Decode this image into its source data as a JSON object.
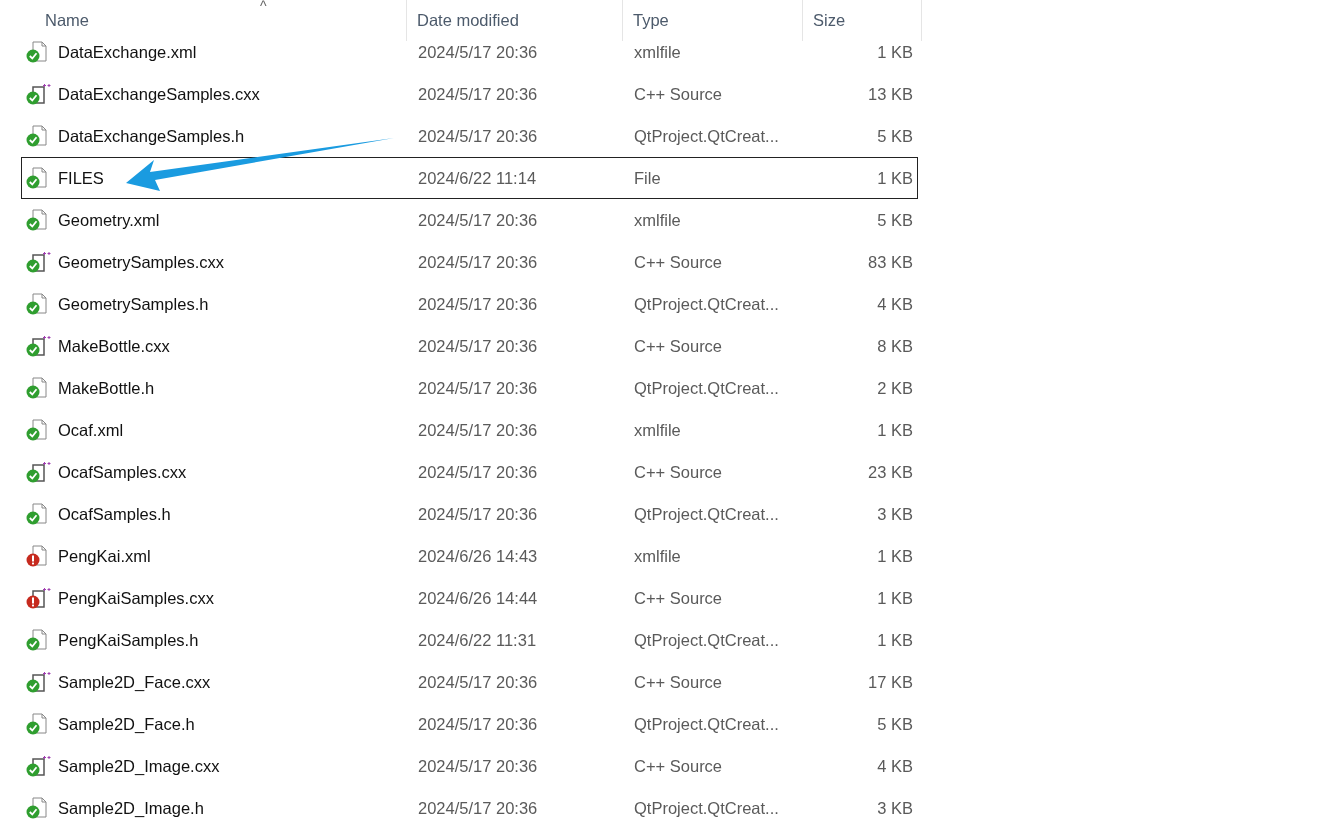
{
  "columns": [
    {
      "label": "Name",
      "sorted": true
    },
    {
      "label": "Date modified",
      "sorted": false
    },
    {
      "label": "Type",
      "sorted": false
    },
    {
      "label": "Size",
      "sorted": false
    }
  ],
  "sort_indicator": "^",
  "rows": [
    {
      "name": "DataExchange.xml",
      "date": "2024/5/17 20:36",
      "type": "xmlfile",
      "size": "1 KB",
      "kind": "document",
      "error": false,
      "focused": false
    },
    {
      "name": "DataExchangeSamples.cxx",
      "date": "2024/5/17 20:36",
      "type": "C++ Source",
      "size": "13 KB",
      "kind": "cpp",
      "error": false,
      "focused": false
    },
    {
      "name": "DataExchangeSamples.h",
      "date": "2024/5/17 20:36",
      "type": "QtProject.QtCreat...",
      "size": "5 KB",
      "kind": "document",
      "error": false,
      "focused": false
    },
    {
      "name": "FILES",
      "date": "2024/6/22 11:14",
      "type": "File",
      "size": "1 KB",
      "kind": "document",
      "error": false,
      "focused": true
    },
    {
      "name": "Geometry.xml",
      "date": "2024/5/17 20:36",
      "type": "xmlfile",
      "size": "5 KB",
      "kind": "document",
      "error": false,
      "focused": false
    },
    {
      "name": "GeometrySamples.cxx",
      "date": "2024/5/17 20:36",
      "type": "C++ Source",
      "size": "83 KB",
      "kind": "cpp",
      "error": false,
      "focused": false
    },
    {
      "name": "GeometrySamples.h",
      "date": "2024/5/17 20:36",
      "type": "QtProject.QtCreat...",
      "size": "4 KB",
      "kind": "document",
      "error": false,
      "focused": false
    },
    {
      "name": "MakeBottle.cxx",
      "date": "2024/5/17 20:36",
      "type": "C++ Source",
      "size": "8 KB",
      "kind": "cpp",
      "error": false,
      "focused": false
    },
    {
      "name": "MakeBottle.h",
      "date": "2024/5/17 20:36",
      "type": "QtProject.QtCreat...",
      "size": "2 KB",
      "kind": "document",
      "error": false,
      "focused": false
    },
    {
      "name": "Ocaf.xml",
      "date": "2024/5/17 20:36",
      "type": "xmlfile",
      "size": "1 KB",
      "kind": "document",
      "error": false,
      "focused": false
    },
    {
      "name": "OcafSamples.cxx",
      "date": "2024/5/17 20:36",
      "type": "C++ Source",
      "size": "23 KB",
      "kind": "cpp",
      "error": false,
      "focused": false
    },
    {
      "name": "OcafSamples.h",
      "date": "2024/5/17 20:36",
      "type": "QtProject.QtCreat...",
      "size": "3 KB",
      "kind": "document",
      "error": false,
      "focused": false
    },
    {
      "name": "PengKai.xml",
      "date": "2024/6/26 14:43",
      "type": "xmlfile",
      "size": "1 KB",
      "kind": "document",
      "error": true,
      "focused": false
    },
    {
      "name": "PengKaiSamples.cxx",
      "date": "2024/6/26 14:44",
      "type": "C++ Source",
      "size": "1 KB",
      "kind": "cpp",
      "error": true,
      "focused": false
    },
    {
      "name": "PengKaiSamples.h",
      "date": "2024/6/22 11:31",
      "type": "QtProject.QtCreat...",
      "size": "1 KB",
      "kind": "document",
      "error": false,
      "focused": false
    },
    {
      "name": "Sample2D_Face.cxx",
      "date": "2024/5/17 20:36",
      "type": "C++ Source",
      "size": "17 KB",
      "kind": "cpp",
      "error": false,
      "focused": false
    },
    {
      "name": "Sample2D_Face.h",
      "date": "2024/5/17 20:36",
      "type": "QtProject.QtCreat...",
      "size": "5 KB",
      "kind": "document",
      "error": false,
      "focused": false
    },
    {
      "name": "Sample2D_Image.cxx",
      "date": "2024/5/17 20:36",
      "type": "C++ Source",
      "size": "4 KB",
      "kind": "cpp",
      "error": false,
      "focused": false
    },
    {
      "name": "Sample2D_Image.h",
      "date": "2024/5/17 20:36",
      "type": "QtProject.QtCreat...",
      "size": "3 KB",
      "kind": "document",
      "error": false,
      "focused": false
    }
  ]
}
